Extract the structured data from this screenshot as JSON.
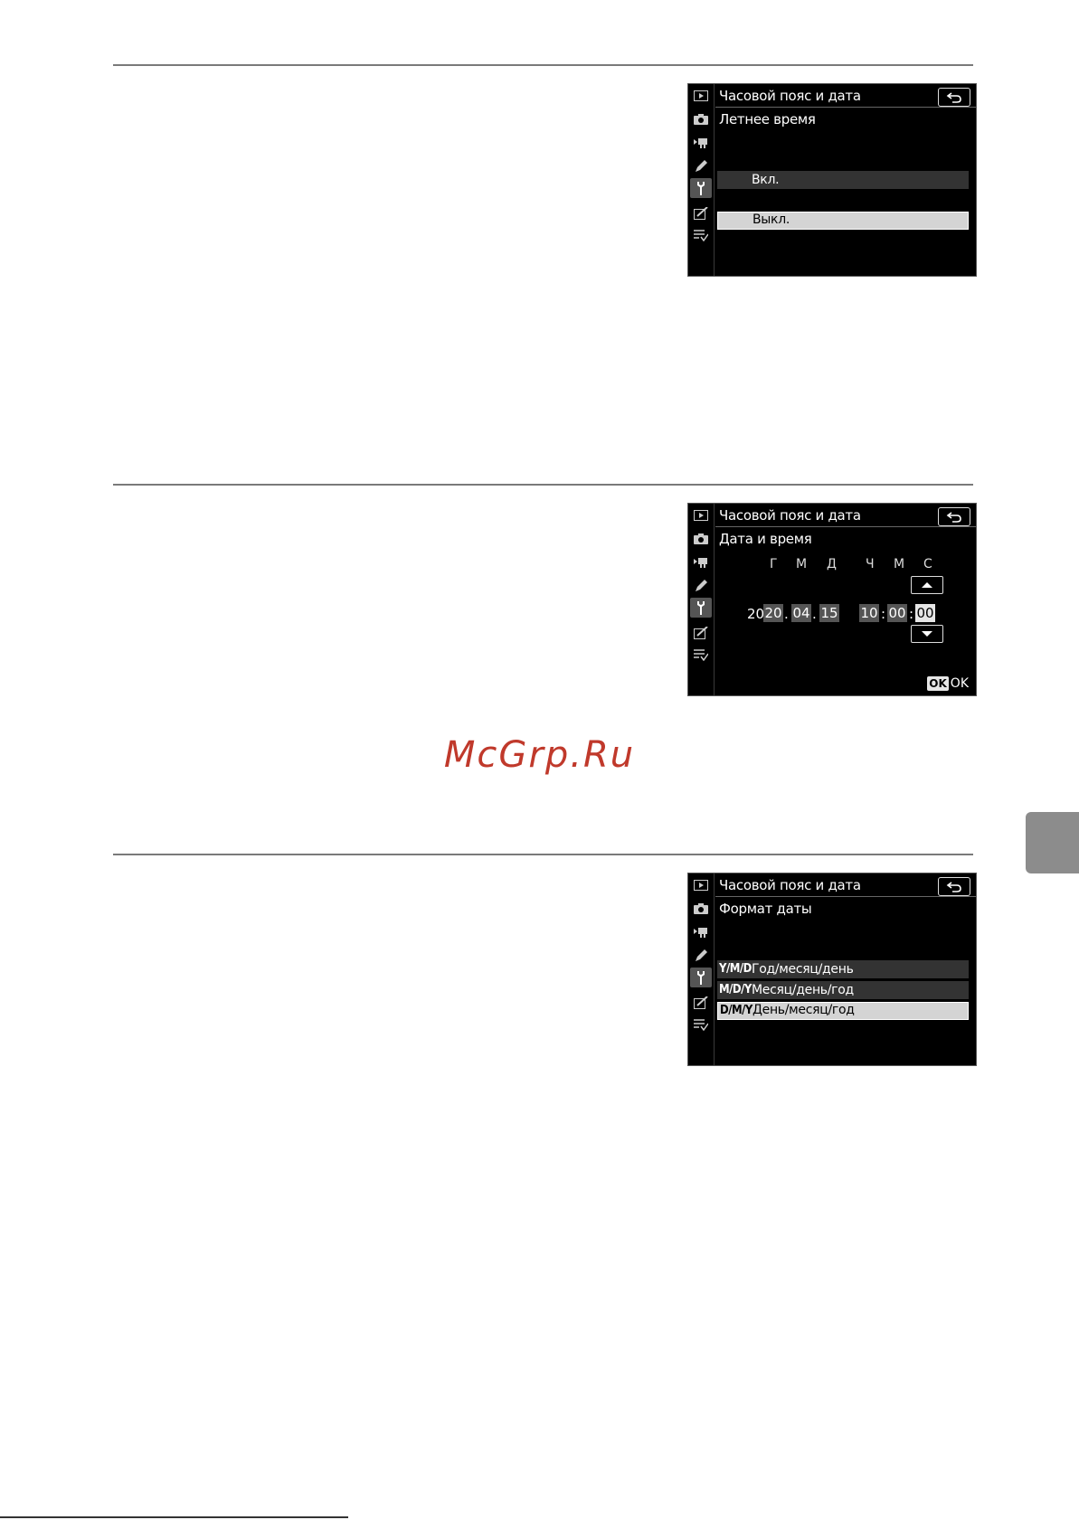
{
  "watermark": "McGrp.Ru",
  "screens": [
    {
      "title": "Часовой пояс и дата",
      "subtitle": "Летнее время",
      "options": [
        {
          "label": "Вкл.",
          "selected": false
        },
        {
          "label": "Выкл.",
          "selected": true
        }
      ]
    },
    {
      "title": "Часовой пояс и дата",
      "subtitle": "Дата и время",
      "headers": {
        "year": "Г",
        "month": "М",
        "day": "Д",
        "hour": "Ч",
        "minute": "М",
        "second": "С"
      },
      "year_prefix": "20",
      "year": "20",
      "month": "04",
      "day": "15",
      "hour": "10",
      "minute": "00",
      "second": "00",
      "date_sep": ".",
      "time_sep": ":",
      "ok_badge": "OK",
      "ok_label": "OK"
    },
    {
      "title": "Часовой пояс и дата",
      "subtitle": "Формат даты",
      "options": [
        {
          "code": "Y/M/D",
          "label": "Год/месяц/день",
          "selected": false
        },
        {
          "code": "M/D/Y",
          "label": "Месяц/день/год",
          "selected": false
        },
        {
          "code": "D/M/Y",
          "label": "День/месяц/год",
          "selected": true
        }
      ]
    }
  ],
  "sidebar_icons": [
    "playback-icon",
    "camera-icon",
    "movie-icon",
    "pencil-icon",
    "wrench-icon",
    "retouch-icon",
    "my-menu-icon"
  ]
}
